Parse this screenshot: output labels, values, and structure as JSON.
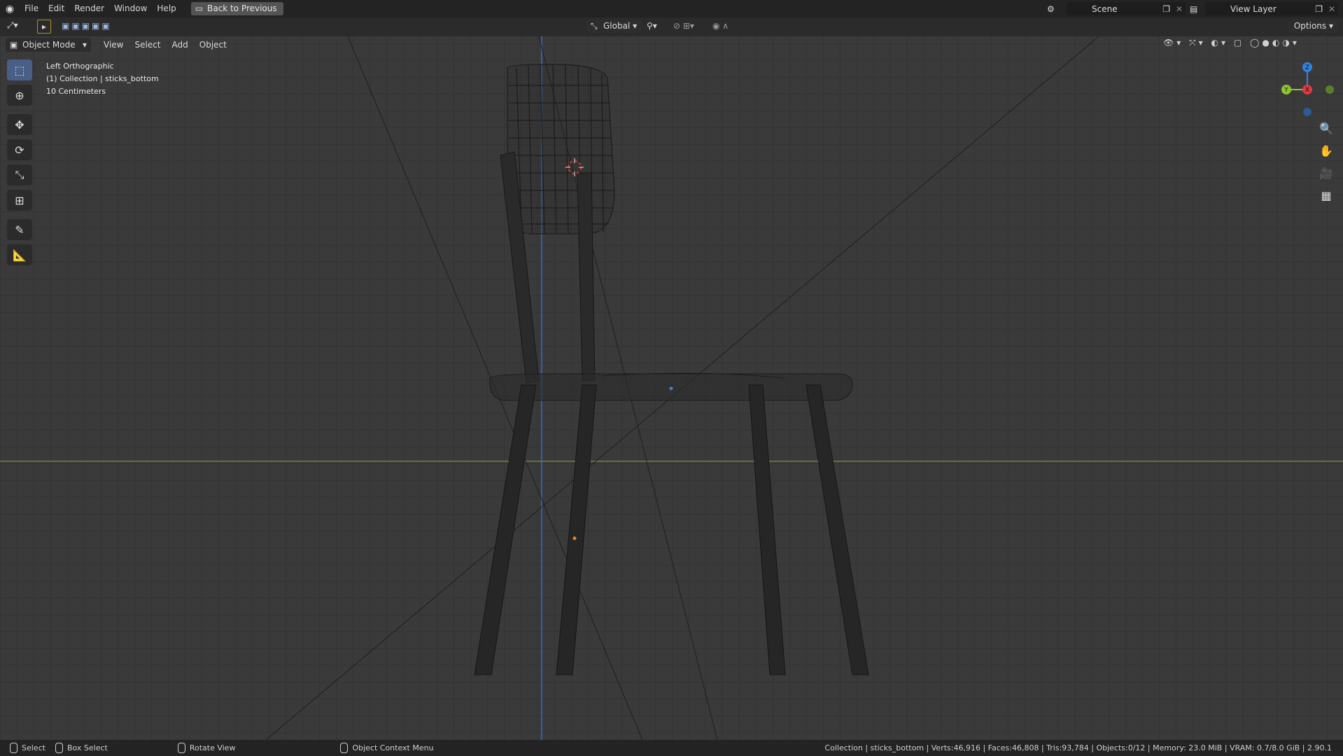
{
  "topbar": {
    "menus": [
      "File",
      "Edit",
      "Render",
      "Window",
      "Help"
    ],
    "back_button": "Back to Previous",
    "scene": "Scene",
    "view_layer": "View Layer"
  },
  "header": {
    "orientation": "Global",
    "options": "Options",
    "mode": "Object Mode",
    "menus": [
      "View",
      "Select",
      "Add",
      "Object"
    ]
  },
  "viewport": {
    "view_name": "Left Orthographic",
    "collection": "(1) Collection | sticks_bottom",
    "scale": "10 Centimeters",
    "gizmo": {
      "z": "Z",
      "y": "Y",
      "x": "X"
    }
  },
  "statusbar": {
    "select": "Select",
    "box_select": "Box Select",
    "rotate_view": "Rotate View",
    "context_menu": "Object Context Menu",
    "stats": "Collection | sticks_bottom | Verts:46,916 | Faces:46,808 | Tris:93,784 | Objects:0/12 | Memory: 23.0 MiB | VRAM: 0.7/8.0 GiB | 2.90.1"
  },
  "colors": {
    "accent": "#4a5f87",
    "x_axis": "#e0393e",
    "y_axis": "#8fc431",
    "z_axis": "#2f84e3"
  }
}
